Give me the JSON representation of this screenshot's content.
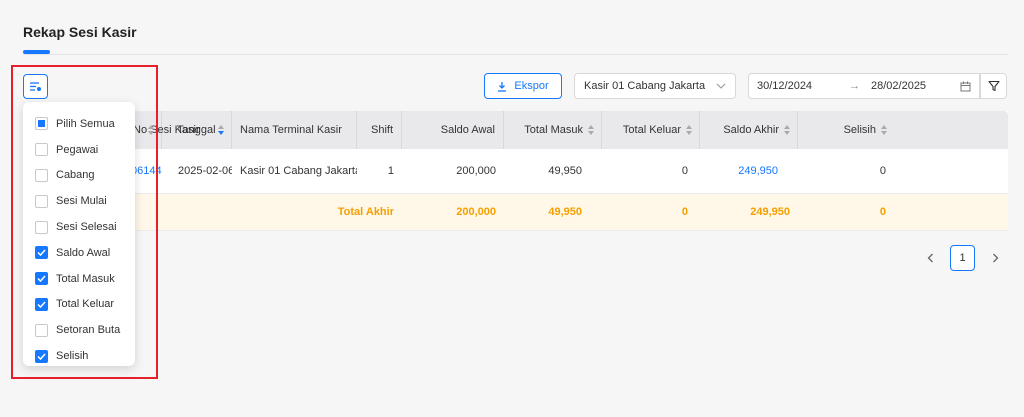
{
  "page": {
    "title": "Rekap Sesi Kasir"
  },
  "toolbar": {
    "export_label": "Ekspor",
    "terminal_value": "Kasir 01 Cabang Jakarta",
    "date_from": "30/12/2024",
    "date_to": "28/02/2025"
  },
  "table": {
    "columns": [
      {
        "label": "No Sesi Kasir"
      },
      {
        "label": "Tanggal"
      },
      {
        "label": "Nama Terminal Kasir"
      },
      {
        "label": "Shift"
      },
      {
        "label": "Saldo Awal"
      },
      {
        "label": "Total Masuk"
      },
      {
        "label": "Total Keluar"
      },
      {
        "label": "Saldo Akhir"
      },
      {
        "label": "Selisih"
      }
    ],
    "rows": [
      {
        "no_sesi": "061446/001",
        "tanggal": "2025-02-06",
        "terminal": "Kasir 01 Cabang Jakarta",
        "shift": "1",
        "saldo_awal": "200,000",
        "total_masuk": "49,950",
        "total_keluar": "0",
        "saldo_akhir": "249,950",
        "selisih": "0"
      }
    ],
    "total": {
      "label": "Total Akhir",
      "saldo_awal": "200,000",
      "total_masuk": "49,950",
      "total_keluar": "0",
      "saldo_akhir": "249,950",
      "selisih": "0"
    }
  },
  "pagination": {
    "current": "1",
    "prev_icon": "chevron-left-icon",
    "next_icon": "chevron-right-icon"
  },
  "column_selector": {
    "items": [
      {
        "label": "Pilih Semua",
        "state": "indeterminate"
      },
      {
        "label": "Pegawai",
        "state": "unchecked"
      },
      {
        "label": "Cabang",
        "state": "unchecked"
      },
      {
        "label": "Sesi Mulai",
        "state": "unchecked"
      },
      {
        "label": "Sesi Selesai",
        "state": "unchecked"
      },
      {
        "label": "Saldo Awal",
        "state": "checked"
      },
      {
        "label": "Total Masuk",
        "state": "checked"
      },
      {
        "label": "Total Keluar",
        "state": "checked"
      },
      {
        "label": "Setoran Buta",
        "state": "unchecked"
      },
      {
        "label": "Selisih",
        "state": "checked"
      }
    ]
  },
  "colors": {
    "accent": "#1677ff",
    "total_text": "#f5a000",
    "total_bg": "#fff7e8",
    "highlight": "#e4202a"
  }
}
